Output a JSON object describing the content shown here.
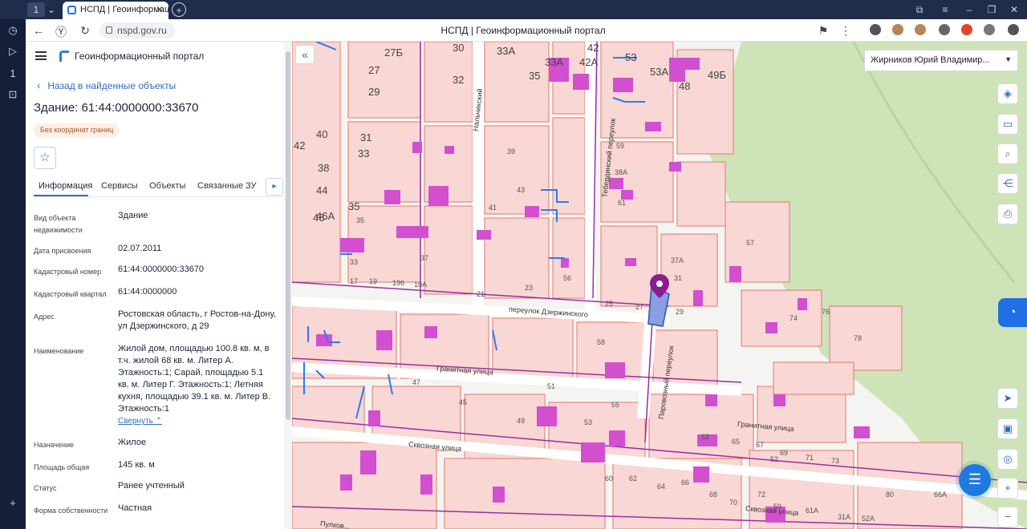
{
  "browser": {
    "tab_title": "НСПД | Геоинформационный портал",
    "url": "nspd.gov.ru",
    "page_title": "НСПД | Геоинформационный портал",
    "new_tab": "+",
    "close": "✕"
  },
  "panel": {
    "app_title": "Геоинформационный портал",
    "back_label": "Назад в найденные объекты",
    "object_title": "Здание: 61:44:0000000:33670",
    "badge": "Без координат границ",
    "tabs": [
      "Информация",
      "Сервисы",
      "Объекты",
      "Связанные ЗУ"
    ],
    "tab_more": "▸",
    "fields": [
      {
        "label": "Вид объекта недвижимости",
        "value": "Здание"
      },
      {
        "label": "Дата присвоения",
        "value": "02.07.2011"
      },
      {
        "label": "Кадастровый номер",
        "value": "61:44:0000000:33670"
      },
      {
        "label": "Кадастровый квартал",
        "value": "61:44:0000000"
      },
      {
        "label": "Адрес",
        "value": "Ростовская область, г Ростов-на-Дону, ул Дзержинского, д 29"
      },
      {
        "label": "Наименование",
        "value": "Жилой дом, площадью 100.8 кв. м, в т.ч. жилой 68 кв. м. Литер А. Этажность:1; Сарай, площадью 5.1 кв. м. Литер Г. Этажность:1; Летняя кухня, площадью 39.1 кв. м. Литер В. Этажность:1"
      },
      {
        "label": "Назначение",
        "value": "Жилое"
      },
      {
        "label": "Площадь общая",
        "value": "145 кв. м"
      },
      {
        "label": "Статус",
        "value": "Ранее учтенный"
      },
      {
        "label": "Форма собственности",
        "value": "Частная"
      }
    ],
    "collapse_label": "Свернуть ⌃"
  },
  "map": {
    "user_name": "Жирников Юрий Владимир...",
    "streets": [
      "переулок Дзержинского",
      "Гранитная улица",
      "Сквозная улица",
      "Паровозный переулок",
      "Тебердинский переулок",
      "Нальчикский",
      "Гранитная улица",
      "Сквозная улица",
      "Пулков..."
    ],
    "big_labels": [
      "30",
      "33А",
      "32",
      "27Б",
      "27",
      "29",
      "31",
      "33",
      "42",
      "38",
      "40",
      "46",
      "44",
      "33А",
      "35",
      "42",
      "42А",
      "35",
      "53",
      "53А",
      "49Б",
      "48",
      "46А"
    ],
    "small_labels": [
      "17",
      "19",
      "196",
      "10А",
      "21",
      "23",
      "25",
      "27",
      "29",
      "31",
      "33",
      "35",
      "37",
      "39",
      "41",
      "43",
      "45",
      "47",
      "49",
      "51",
      "53",
      "55",
      "57",
      "59",
      "61",
      "63",
      "65",
      "67",
      "69",
      "71",
      "73",
      "56",
      "58",
      "60",
      "62",
      "64",
      "66",
      "68",
      "70",
      "72",
      "74",
      "76",
      "78",
      "80",
      "66А",
      "59",
      "61А",
      "31А",
      "52А",
      "52",
      "38А",
      "37А"
    ]
  },
  "icons": {
    "layers": "layers-icon",
    "ruler": "ruler-icon",
    "search-area": "area-search-icon",
    "share": "share-icon",
    "print": "print-icon",
    "chat": "chat-icon"
  },
  "colors": {
    "accent": "#2f6ebf",
    "parcel_fill": "#f8d7d4",
    "parcel_stroke": "#e07b6a",
    "building_fill": "#d24fd0",
    "selected_fill": "#8a9fe0",
    "quarter_line": "#9b2ea0",
    "green_area": "#cfe3b8"
  }
}
